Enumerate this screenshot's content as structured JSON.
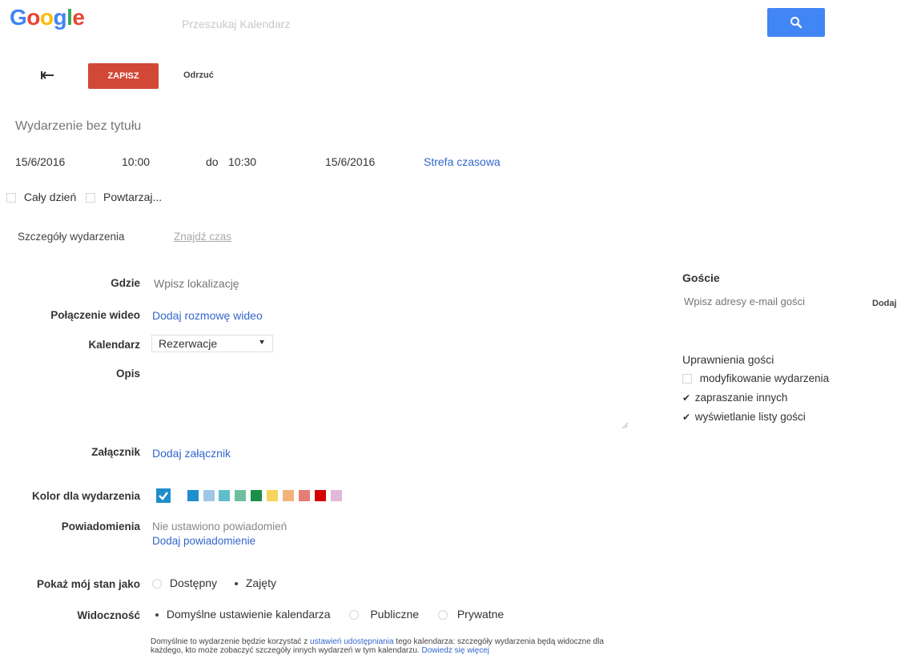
{
  "header": {
    "logo_letters": [
      {
        "ch": "G",
        "color": "#4285f4"
      },
      {
        "ch": "o",
        "color": "#ea4335"
      },
      {
        "ch": "o",
        "color": "#fbbc05"
      },
      {
        "ch": "g",
        "color": "#4285f4"
      },
      {
        "ch": "l",
        "color": "#34a853"
      },
      {
        "ch": "e",
        "color": "#ea4335"
      }
    ],
    "search_placeholder": "Przeszukaj Kalendarz",
    "search_icon": "search-icon"
  },
  "toolbar": {
    "back_icon": "back-arrow-icon",
    "save_label": "ZAPISZ",
    "discard_label": "Odrzuć"
  },
  "event": {
    "title_placeholder": "Wydarzenie bez tytułu",
    "start_date": "15/6/2016",
    "start_time": "10:00",
    "to_label": "do",
    "end_time": "10:30",
    "end_date": "15/6/2016",
    "timezone_link": "Strefa czasowa",
    "all_day_label": "Cały dzień",
    "repeat_label": "Powtarzaj..."
  },
  "tabs": {
    "details": "Szczegóły wydarzenia",
    "find_time": "Znajdź czas"
  },
  "form": {
    "where_label": "Gdzie",
    "where_placeholder": "Wpisz lokalizację",
    "video_label": "Połączenie wideo",
    "video_link": "Dodaj rozmowę wideo",
    "calendar_label": "Kalendarz",
    "calendar_value": "Rezerwacje",
    "description_label": "Opis",
    "attachment_label": "Załącznik",
    "attachment_link": "Dodaj załącznik",
    "color_label": "Kolor dla wydarzenia",
    "colors": [
      "#1f8ecd",
      "#1f8ecd",
      "#9fc6e7",
      "#5fbeca",
      "#6ebe9f",
      "#1b8f4a",
      "#f7d45c",
      "#f2b37a",
      "#e67c73",
      "#d50000",
      "#e1b8d8"
    ],
    "notifications_label": "Powiadomienia",
    "no_notifications": "Nie ustawiono powiadomień",
    "add_notification": "Dodaj powiadomienie",
    "status_label": "Pokaż mój stan jako",
    "status_free": "Dostępny",
    "status_busy": "Zajęty",
    "visibility_label": "Widoczność",
    "visibility_default": "Domyślne ustawienie kalendarza",
    "visibility_public": "Publiczne",
    "visibility_private": "Prywatne",
    "note_part1": "Domyślnie to wydarzenie będzie korzystać z ",
    "note_link": "ustawień udostępniania",
    "note_part2": " tego kalendarza: szczegóły wydarzenia będą widoczne dla każdego, kto może zobaczyć szczegóły innych wydarzeń w tym kalendarzu. ",
    "note_learn_more": "Dowiedz się więcej"
  },
  "guests": {
    "title": "Goście",
    "input_placeholder": "Wpisz adresy e-mail gości",
    "add_label": "Dodaj",
    "permissions_title": "Uprawnienia gości",
    "perm_modify": "modyfikowanie wydarzenia",
    "perm_invite": "zapraszanie innych",
    "perm_see_list": "wyświetlanie listy gości"
  }
}
